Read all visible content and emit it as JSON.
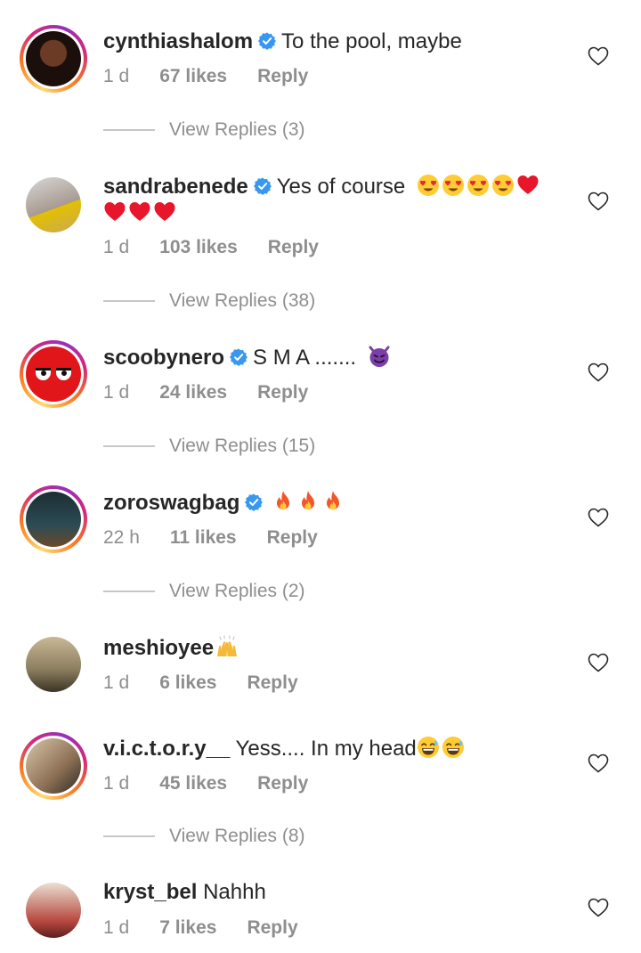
{
  "comments": [
    {
      "username": "cynthiashalom",
      "verified": true,
      "text": "To the pool, maybe",
      "time": "1 d",
      "likes": "67 likes",
      "reply": "Reply",
      "view_replies": "View Replies (3)",
      "story_ring": true,
      "avatar": "woman-portrait"
    },
    {
      "username": "sandrabenede",
      "verified": true,
      "text": "Yes of course",
      "emojis_line1": [
        "heart-eyes",
        "heart-eyes",
        "heart-eyes",
        "heart-eyes",
        "red-heart"
      ],
      "emojis_line2": [
        "red-heart",
        "red-heart",
        "red-heart"
      ],
      "time": "1 d",
      "likes": "103 likes",
      "reply": "Reply",
      "view_replies": "View Replies (38)",
      "story_ring": false,
      "avatar": "woman-yellow-swimsuit"
    },
    {
      "username": "scoobynero",
      "verified": true,
      "text": "S M A .......",
      "emojis_line1": [
        "smiling-imp"
      ],
      "time": "1 d",
      "likes": "24 likes",
      "reply": "Reply",
      "view_replies": "View Replies (15)",
      "story_ring": true,
      "avatar": "red-angry-face"
    },
    {
      "username": "zoroswagbag",
      "verified": true,
      "text": "",
      "emojis_line1": [
        "fire",
        "fire",
        "fire"
      ],
      "time": "22 h",
      "likes": "11 likes",
      "reply": "Reply",
      "view_replies": "View Replies (2)",
      "story_ring": true,
      "avatar": "man-standing"
    },
    {
      "username": "meshioyee",
      "verified": false,
      "text": "",
      "emojis_line1": [
        "raising-hands"
      ],
      "time": "1 d",
      "likes": "6 likes",
      "reply": "Reply",
      "story_ring": false,
      "avatar": "man-seated"
    },
    {
      "username": "v.i.c.t.o.r.y__",
      "verified": false,
      "text": "Yess.... In my head",
      "emojis_line1": [
        "grinning-sweat",
        "grinning-sweat"
      ],
      "time": "1 d",
      "likes": "45 likes",
      "reply": "Reply",
      "view_replies": "View Replies (8)",
      "story_ring": true,
      "avatar": "woman-back"
    },
    {
      "username": "kryst_bel",
      "verified": false,
      "text": "Nahhh",
      "time": "1 d",
      "likes": "7 likes",
      "reply": "Reply",
      "story_ring": false,
      "avatar": "woman-red-top"
    }
  ],
  "colors": {
    "text": "#262626",
    "muted": "#8e8e8e",
    "verified": "#3897f0",
    "divider": "#c7c7c7"
  }
}
